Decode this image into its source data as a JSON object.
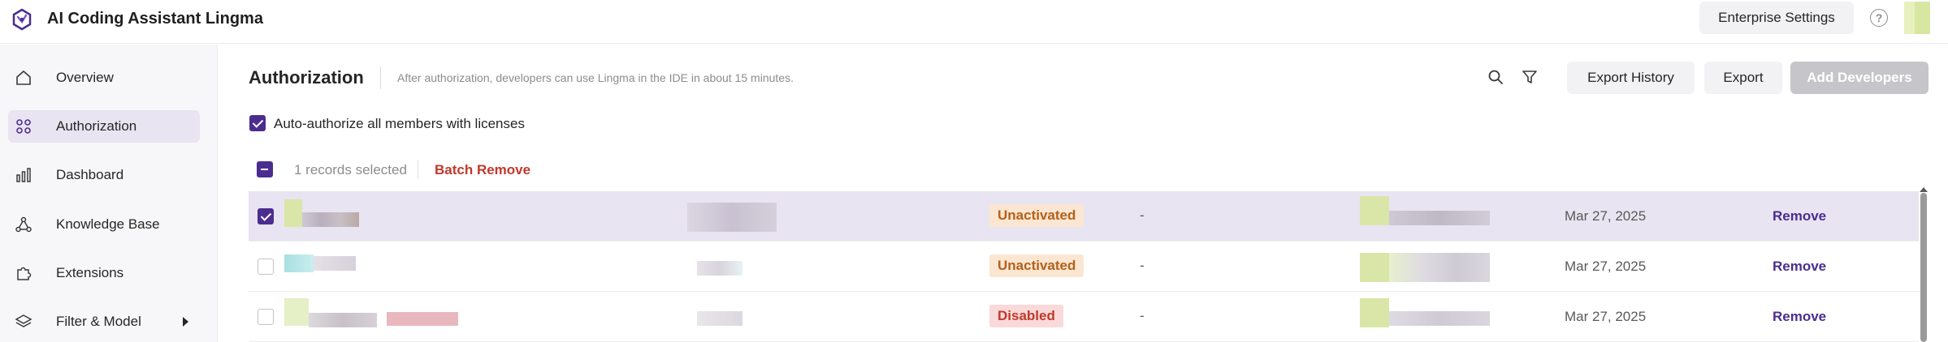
{
  "app": {
    "title": "AI Coding Assistant Lingma",
    "enterprise_settings_label": "Enterprise Settings",
    "help_glyph": "?"
  },
  "sidebar": {
    "items": [
      {
        "label": "Overview",
        "icon": "home-icon",
        "active": false
      },
      {
        "label": "Authorization",
        "icon": "apps-grid-icon",
        "active": true
      },
      {
        "label": "Dashboard",
        "icon": "bar-chart-icon",
        "active": false
      },
      {
        "label": "Knowledge Base",
        "icon": "knowledge-icon",
        "active": false
      },
      {
        "label": "Extensions",
        "icon": "puzzle-icon",
        "active": false
      },
      {
        "label": "Filter & Model",
        "icon": "layers-icon",
        "active": false,
        "has_submenu": true
      }
    ]
  },
  "main": {
    "title": "Authorization",
    "description": "After authorization, developers can use Lingma in the IDE in about 15 minutes.",
    "toolbar": {
      "search_icon": "search-icon",
      "filter_icon": "filter-icon",
      "export_history_label": "Export History",
      "export_label": "Export",
      "add_developers_label": "Add Developers"
    },
    "auto_authorize": {
      "label": "Auto-authorize all members with licenses",
      "checked": true
    },
    "selection": {
      "text": "1 records selected",
      "batch_remove_label": "Batch Remove"
    },
    "rows": [
      {
        "selected": true,
        "status": "Unactivated",
        "status_type": "unactivated",
        "col_dash": "-",
        "date": "Mar 27, 2025",
        "action": "Remove"
      },
      {
        "selected": false,
        "status": "Unactivated",
        "status_type": "unactivated",
        "col_dash": "-",
        "date": "Mar 27, 2025",
        "action": "Remove"
      },
      {
        "selected": false,
        "status": "Disabled",
        "status_type": "disabled",
        "col_dash": "-",
        "date": "Mar 27, 2025",
        "action": "Remove"
      }
    ]
  },
  "colors": {
    "accent": "#4b2d8f",
    "active_nav_bg": "#e9e4f1",
    "danger": "#c0392b",
    "warning_text": "#b4601b"
  }
}
